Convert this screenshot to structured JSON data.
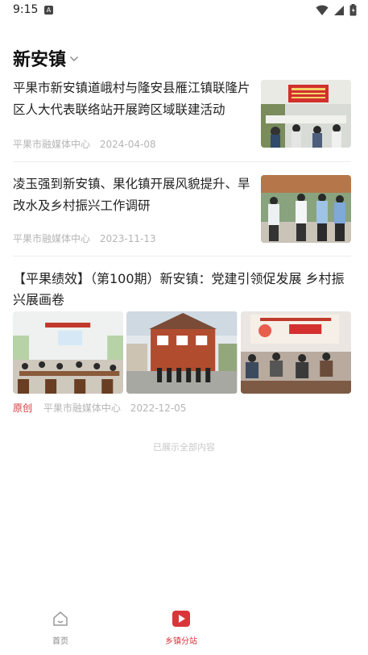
{
  "status_bar": {
    "time": "9:15",
    "notif_letter": "A"
  },
  "header": {
    "title": "新安镇"
  },
  "articles": [
    {
      "title": "平果市新安镇道峨村与隆安县雁江镇联隆片区人大代表联络站开展跨区域联建活动",
      "source": "平果市融媒体中心",
      "date": "2024-04-08"
    },
    {
      "title": "凌玉强到新安镇、果化镇开展风貌提升、旱改水及乡村振兴工作调研",
      "source": "平果市融媒体中心",
      "date": "2023-11-13"
    },
    {
      "title": "【平果绩效】（第100期）新安镇：党建引领促发展 乡村振兴展画卷",
      "badge": "原创",
      "source": "平果市融媒体中心",
      "date": "2022-12-05"
    }
  ],
  "end_notice": "已展示全部内容",
  "tabbar": {
    "home_label": "首页",
    "town_label": "乡镇分站"
  },
  "colors": {
    "accent": "#d8363a"
  },
  "icons": {
    "home": "home-icon",
    "town": "play-square-icon",
    "dropdown": "chevron-down-icon"
  }
}
